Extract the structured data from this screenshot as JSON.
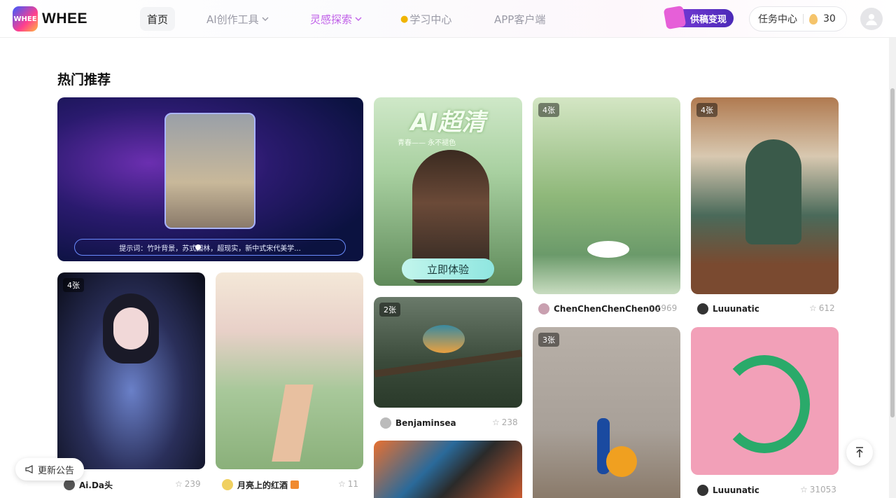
{
  "header": {
    "logo_text": "WHEE",
    "logo_mark": "WHEE",
    "nav": [
      {
        "label": "首页",
        "active": true
      },
      {
        "label": "AI创作工具",
        "dropdown": true
      },
      {
        "label": "灵感探索",
        "dropdown": true
      },
      {
        "label": "学习中心",
        "icon": "lightbulb-icon"
      },
      {
        "label": "APP客户端"
      }
    ],
    "promo_label": "供稿变现",
    "task_label": "任务中心",
    "credits": "30"
  },
  "section_title": "热门推荐",
  "banner": {
    "caption": "提示词：竹叶背景，苏式园林，超现实，新中式宋代美学..."
  },
  "promo_card": {
    "headline": "AI超清",
    "sub": "青春—— 永不褪色",
    "cta": "立即体验"
  },
  "cards": [
    {
      "count": "4张",
      "author": "ChenChenChenChen00",
      "likes": "2969"
    },
    {
      "count": "4张",
      "author": "Luuunatic",
      "likes": "612"
    },
    {
      "count": "4张",
      "author": "Ai.Da头",
      "likes": "239"
    },
    {
      "author": "月亮上的红酒",
      "likes": "11"
    },
    {
      "count": "2张",
      "author": "Benjaminsea",
      "likes": "238"
    },
    {
      "count": "3张"
    },
    {
      "author": "Luuunatic",
      "likes": "31053"
    }
  ],
  "notice_label": "更新公告",
  "colors": {
    "accent": "#c060e8",
    "promo": "#5a2fc4"
  }
}
